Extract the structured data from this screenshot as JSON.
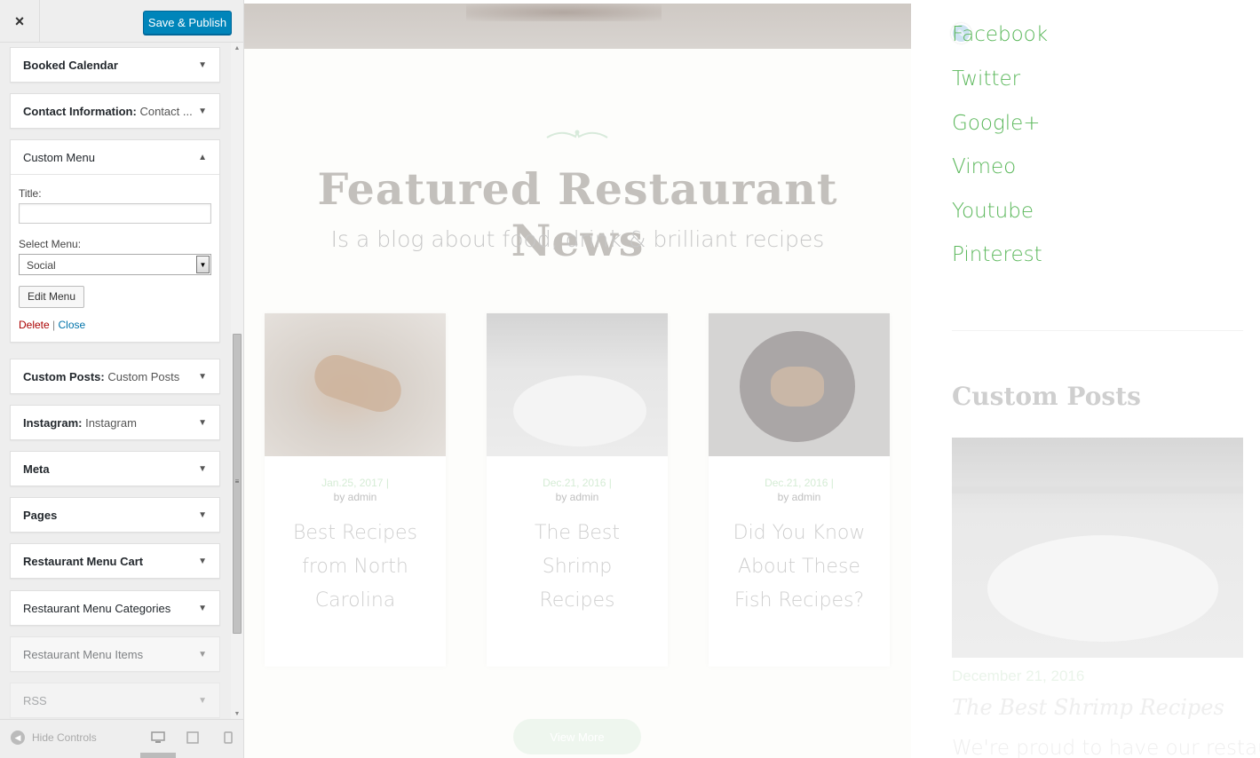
{
  "header": {
    "close_label": "×",
    "publish_label": "Save & Publish"
  },
  "widgets": [
    {
      "title": "Booked Calendar",
      "subtitle": ""
    },
    {
      "title": "Contact Information:",
      "subtitle": "Contact ..."
    },
    {
      "title": "Custom Menu",
      "subtitle": "",
      "expanded": true
    },
    {
      "title": "Custom Posts:",
      "subtitle": "Custom Posts"
    },
    {
      "title": "Instagram:",
      "subtitle": "Instagram"
    },
    {
      "title": "Meta",
      "subtitle": ""
    },
    {
      "title": "Pages",
      "subtitle": ""
    },
    {
      "title": "Restaurant Menu Cart",
      "subtitle": ""
    },
    {
      "title": "Restaurant Menu Categories",
      "subtitle": ""
    },
    {
      "title": "Restaurant Menu Items",
      "subtitle": ""
    },
    {
      "title": "RSS",
      "subtitle": ""
    }
  ],
  "custom_menu": {
    "title_label": "Title:",
    "title_value": "",
    "select_label": "Select Menu:",
    "select_value": "Social",
    "edit_button": "Edit Menu",
    "delete_link": "Delete",
    "separator": "|",
    "close_link": "Close"
  },
  "footer": {
    "hide_controls": "Hide Controls"
  },
  "preview": {
    "featured_title": "Featured Restaurant News",
    "featured_subtitle": "Is a blog about food, drink & brilliant recipes",
    "posts": [
      {
        "date": "Jan.25, 2017",
        "sep": "|",
        "author": "by admin",
        "title": "Best Recipes from North Carolina"
      },
      {
        "date": "Dec.21, 2016",
        "sep": "|",
        "author": "by admin",
        "title": "The Best Shrimp Recipes"
      },
      {
        "date": "Dec.21, 2016",
        "sep": "|",
        "author": "by admin",
        "title": "Did You Know About These Fish Recipes?"
      }
    ],
    "view_more": "View More",
    "social_links": [
      "Facebook",
      "Twitter",
      "Google+",
      "Vimeo",
      "Youtube",
      "Pinterest"
    ],
    "custom_posts_title": "Custom Posts",
    "custom_post_date": "December 21, 2016",
    "custom_post_title": "The Best Shrimp Recipes",
    "custom_post_excerpt": "We're proud to have our restau"
  },
  "colors": {
    "publish": "#0085ba",
    "social_link": "#5cb85c",
    "delete_link": "#aa0000",
    "close_link": "#0073aa"
  }
}
